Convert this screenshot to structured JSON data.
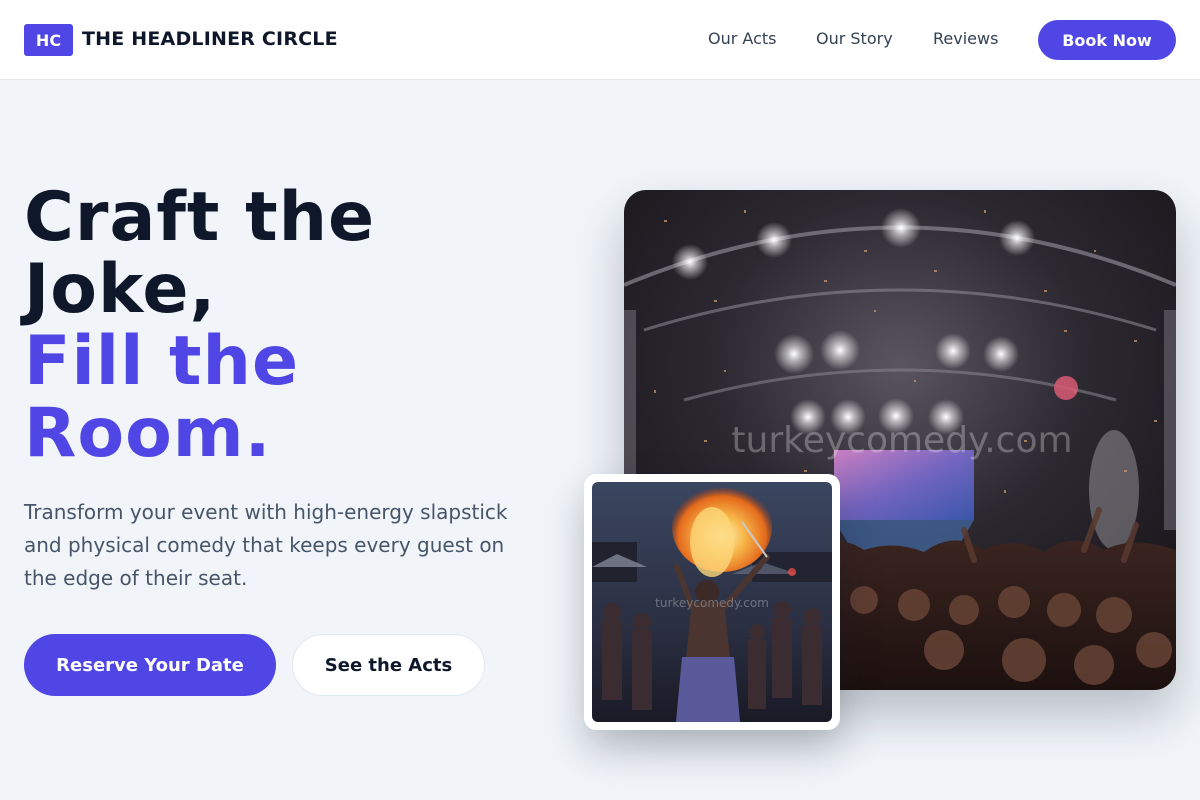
{
  "header": {
    "logo_badge": "HC",
    "brand_name": "THE HEADLINER CIRCLE",
    "nav": {
      "acts": "Our Acts",
      "story": "Our Story",
      "reviews": "Reviews"
    },
    "cta": "Book Now"
  },
  "hero": {
    "title_line1": "Craft the",
    "title_line2": "Joke,",
    "title_line3": "Fill the",
    "title_line4": "Room.",
    "subtitle": "Transform your event with high-energy slapstick and physical comedy that keeps every guest on the edge of their seat.",
    "primary_button": "Reserve Your Date",
    "secondary_button": "See the Acts"
  },
  "images": {
    "main_watermark": "turkeycomedy.com",
    "inset_watermark": "turkeycomedy.com"
  },
  "colors": {
    "accent": "#4f46e5",
    "heading": "#0f172a",
    "body_text": "#475569",
    "background": "#f1f5f9"
  }
}
